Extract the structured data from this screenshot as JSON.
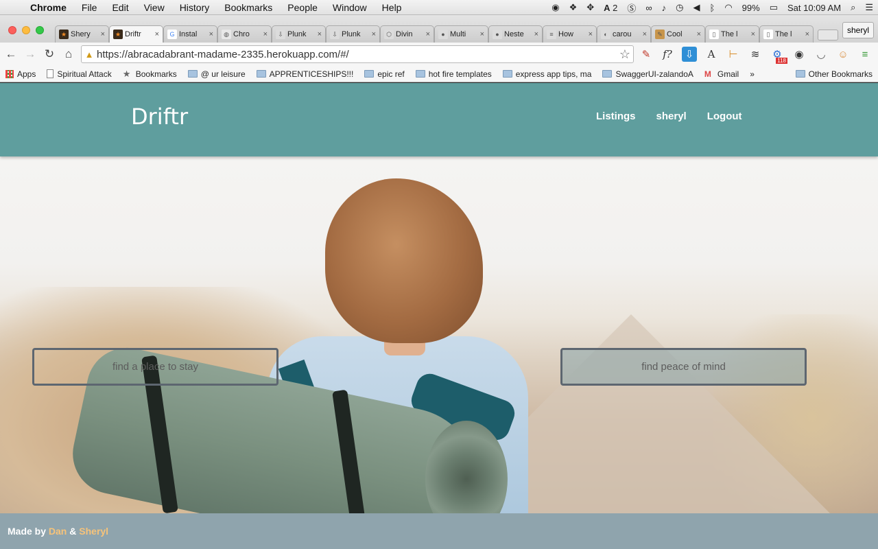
{
  "menubar": {
    "app": "Chrome",
    "items": [
      "File",
      "Edit",
      "View",
      "History",
      "Bookmarks",
      "People",
      "Window",
      "Help"
    ],
    "tray": {
      "adobe_count": "2",
      "battery": "99%",
      "clock": "Sat 10:09 AM"
    }
  },
  "tabs": [
    {
      "label": "Shery",
      "favicon": "orange-star",
      "active": false
    },
    {
      "label": "Driftr",
      "favicon": "orange-star",
      "active": true
    },
    {
      "label": "Instal",
      "favicon": "google-g",
      "active": false
    },
    {
      "label": "Chro",
      "favicon": "chrome",
      "active": false
    },
    {
      "label": "Plunk",
      "favicon": "download",
      "active": false
    },
    {
      "label": "Plunk",
      "favicon": "download",
      "active": false
    },
    {
      "label": "Divin",
      "favicon": "cube",
      "active": false
    },
    {
      "label": "Multi",
      "favicon": "github",
      "active": false
    },
    {
      "label": "Neste",
      "favicon": "github",
      "active": false
    },
    {
      "label": "How",
      "favicon": "stack",
      "active": false
    },
    {
      "label": "carou",
      "favicon": "circle",
      "active": false
    },
    {
      "label": "Cool",
      "favicon": "brush",
      "active": false
    },
    {
      "label": "The l",
      "favicon": "page",
      "active": false
    },
    {
      "label": "The l",
      "favicon": "page",
      "active": false
    }
  ],
  "profile_name": "sheryl",
  "toolbar": {
    "url": "https://abracadabrant-madame-2335.herokuapp.com/#/",
    "extensions_badge": "118"
  },
  "bookmarks": [
    {
      "label": "Apps",
      "icon": "apps-grid"
    },
    {
      "label": "Spiritual Attack",
      "icon": "page"
    },
    {
      "label": "Bookmarks",
      "icon": "star"
    },
    {
      "label": "@ ur leisure",
      "icon": "folder"
    },
    {
      "label": "APPRENTICESHIPS!!!",
      "icon": "folder"
    },
    {
      "label": "epic ref",
      "icon": "folder"
    },
    {
      "label": "hot fire templates",
      "icon": "folder"
    },
    {
      "label": "express app tips, ma",
      "icon": "folder"
    },
    {
      "label": "SwaggerUI-zalandoA",
      "icon": "folder"
    },
    {
      "label": "Gmail",
      "icon": "gmail"
    },
    {
      "label": "»",
      "icon": ""
    },
    {
      "label": "Other Bookmarks",
      "icon": "folder"
    }
  ],
  "site": {
    "brand": "Driftr",
    "nav": [
      "Listings",
      "sheryl",
      "Logout"
    ],
    "cta_left": "find a place to stay",
    "cta_right": "find peace of mind",
    "footer": {
      "prefix": "Made by",
      "author1": "Dan",
      "amp": "&",
      "author2": "Sheryl"
    }
  }
}
